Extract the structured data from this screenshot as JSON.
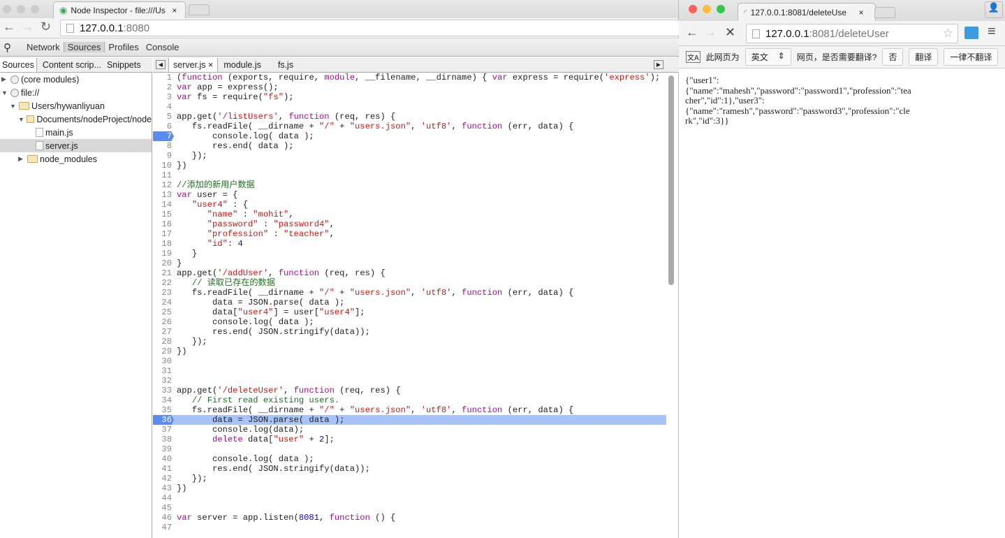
{
  "left_browser": {
    "tab_title": "Node Inspector - file:///Us",
    "url_host": "127.0.0.1",
    "url_rest": ":8080",
    "devtools_tabs": [
      "Network",
      "Sources",
      "Profiles",
      "Console"
    ],
    "navigator_tabs": [
      "Sources",
      "Content scrip...",
      "Snippets"
    ],
    "tree": [
      {
        "label": "(core modules)",
        "depth": 0,
        "icon": "globe-icon",
        "arrow": "▶"
      },
      {
        "label": "file://",
        "depth": 0,
        "icon": "globe-icon",
        "arrow": "▼"
      },
      {
        "label": "Users/hywanliyuan",
        "depth": 1,
        "icon": "folder-icon",
        "arrow": "▼"
      },
      {
        "label": "Documents/nodeProject/node",
        "depth": 2,
        "icon": "folder-icon",
        "arrow": "▼"
      },
      {
        "label": "main.js",
        "depth": 3,
        "icon": "file-icon",
        "arrow": ""
      },
      {
        "label": "server.js",
        "depth": 3,
        "icon": "file-icon",
        "arrow": "",
        "selected": true
      },
      {
        "label": "node_modules",
        "depth": 2,
        "icon": "folder-icon",
        "arrow": "▶"
      }
    ],
    "editor_tabs": [
      "server.js",
      "module.js",
      "fs.js"
    ],
    "breakpoint_line": 7,
    "current_line": 36,
    "code": [
      [
        [
          "p",
          "("
        ],
        [
          "k",
          "function"
        ],
        [
          "p",
          " (exports, require, "
        ],
        [
          "k",
          "module"
        ],
        [
          "p",
          ", __filename, __dirname) { "
        ],
        [
          "k",
          "var"
        ],
        [
          "p",
          " express = require("
        ],
        [
          "s",
          "'express'"
        ],
        [
          "p",
          ");"
        ]
      ],
      [
        [
          "k",
          "var"
        ],
        [
          "p",
          " app = express();"
        ]
      ],
      [
        [
          "k",
          "var"
        ],
        [
          "p",
          " fs = require("
        ],
        [
          "s",
          "\"fs\""
        ],
        [
          "p",
          ");"
        ]
      ],
      [],
      [
        [
          "p",
          "app.get("
        ],
        [
          "s",
          "'/listUsers'"
        ],
        [
          "p",
          ", "
        ],
        [
          "k",
          "function"
        ],
        [
          "p",
          " (req, res) {"
        ]
      ],
      [
        [
          "p",
          "   fs.readFile( __dirname + "
        ],
        [
          "s",
          "\"/\""
        ],
        [
          "p",
          " + "
        ],
        [
          "s",
          "\"users.json\""
        ],
        [
          "p",
          ", "
        ],
        [
          "s",
          "'utf8'"
        ],
        [
          "p",
          ", "
        ],
        [
          "k",
          "function"
        ],
        [
          "p",
          " (err, data) {"
        ]
      ],
      [
        [
          "p",
          "       console.log( data );"
        ]
      ],
      [
        [
          "p",
          "       res.end( data );"
        ]
      ],
      [
        [
          "p",
          "   });"
        ]
      ],
      [
        [
          "p",
          "})"
        ]
      ],
      [],
      [
        [
          "c",
          "//添加的新用户数据"
        ]
      ],
      [
        [
          "k",
          "var"
        ],
        [
          "p",
          " user = {"
        ]
      ],
      [
        [
          "p",
          "   "
        ],
        [
          "s",
          "\"user4\""
        ],
        [
          "p",
          " : {"
        ]
      ],
      [
        [
          "p",
          "      "
        ],
        [
          "s",
          "\"name\""
        ],
        [
          "p",
          " : "
        ],
        [
          "s",
          "\"mohit\""
        ],
        [
          "p",
          ","
        ]
      ],
      [
        [
          "p",
          "      "
        ],
        [
          "s",
          "\"password\""
        ],
        [
          "p",
          " : "
        ],
        [
          "s",
          "\"password4\""
        ],
        [
          "p",
          ","
        ]
      ],
      [
        [
          "p",
          "      "
        ],
        [
          "s",
          "\"profession\""
        ],
        [
          "p",
          " : "
        ],
        [
          "s",
          "\"teacher\""
        ],
        [
          "p",
          ","
        ]
      ],
      [
        [
          "p",
          "      "
        ],
        [
          "s",
          "\"id\""
        ],
        [
          "p",
          ": "
        ],
        [
          "n",
          "4"
        ]
      ],
      [
        [
          "p",
          "   }"
        ]
      ],
      [
        [
          "p",
          "}"
        ]
      ],
      [
        [
          "p",
          "app.get("
        ],
        [
          "s",
          "'/addUser'"
        ],
        [
          "p",
          ", "
        ],
        [
          "k",
          "function"
        ],
        [
          "p",
          " (req, res) {"
        ]
      ],
      [
        [
          "p",
          "   "
        ],
        [
          "c",
          "// 读取已存在的数据"
        ]
      ],
      [
        [
          "p",
          "   fs.readFile( __dirname + "
        ],
        [
          "s",
          "\"/\""
        ],
        [
          "p",
          " + "
        ],
        [
          "s",
          "\"users.json\""
        ],
        [
          "p",
          ", "
        ],
        [
          "s",
          "'utf8'"
        ],
        [
          "p",
          ", "
        ],
        [
          "k",
          "function"
        ],
        [
          "p",
          " (err, data) {"
        ]
      ],
      [
        [
          "p",
          "       data = JSON.parse( data );"
        ]
      ],
      [
        [
          "p",
          "       data["
        ],
        [
          "s",
          "\"user4\""
        ],
        [
          "p",
          "] = user["
        ],
        [
          "s",
          "\"user4\""
        ],
        [
          "p",
          "];"
        ]
      ],
      [
        [
          "p",
          "       console.log( data );"
        ]
      ],
      [
        [
          "p",
          "       res.end( JSON.stringify(data));"
        ]
      ],
      [
        [
          "p",
          "   });"
        ]
      ],
      [
        [
          "p",
          "})"
        ]
      ],
      [],
      [],
      [],
      [
        [
          "p",
          "app.get("
        ],
        [
          "s",
          "'/deleteUser'"
        ],
        [
          "p",
          ", "
        ],
        [
          "k",
          "function"
        ],
        [
          "p",
          " (req, res) {"
        ]
      ],
      [
        [
          "p",
          "   "
        ],
        [
          "c",
          "// First read existing users."
        ]
      ],
      [
        [
          "p",
          "   fs.readFile( __dirname + "
        ],
        [
          "s",
          "\"/\""
        ],
        [
          "p",
          " + "
        ],
        [
          "s",
          "\"users.json\""
        ],
        [
          "p",
          ", "
        ],
        [
          "s",
          "'utf8'"
        ],
        [
          "p",
          ", "
        ],
        [
          "k",
          "function"
        ],
        [
          "p",
          " (err, data) {"
        ]
      ],
      [
        [
          "p",
          "       data = JSON.parse( data );"
        ]
      ],
      [
        [
          "p",
          "       console.log(data);"
        ]
      ],
      [
        [
          "p",
          "       "
        ],
        [
          "k",
          "delete"
        ],
        [
          "p",
          " data["
        ],
        [
          "s",
          "\"user\""
        ],
        [
          "p",
          " + "
        ],
        [
          "n",
          "2"
        ],
        [
          "p",
          "];"
        ]
      ],
      [],
      [
        [
          "p",
          "       console.log( data );"
        ]
      ],
      [
        [
          "p",
          "       res.end( JSON.stringify(data));"
        ]
      ],
      [
        [
          "p",
          "   });"
        ]
      ],
      [
        [
          "p",
          "})"
        ]
      ],
      [],
      [],
      [
        [
          "k",
          "var"
        ],
        [
          "p",
          " server = app.listen("
        ],
        [
          "n",
          "8081"
        ],
        [
          "p",
          ", "
        ],
        [
          "k",
          "function"
        ],
        [
          "p",
          " () {"
        ]
      ],
      []
    ]
  },
  "right_browser": {
    "tab_title": "127.0.0.1:8081/deleteUse",
    "url_host": "127.0.0.1",
    "url_rest": ":8081/deleteUser",
    "translate": {
      "prefix": "此网页为",
      "language": "英文",
      "question": "网页，是否需要翻译?",
      "no": "否",
      "translate": "翻译",
      "never": "一律不翻译"
    },
    "body": "{\"user1\":\n{\"name\":\"mahesh\",\"password\":\"password1\",\"profession\":\"tea\ncher\",\"id\":1},\"user3\":\n{\"name\":\"ramesh\",\"password\":\"password3\",\"profession\":\"cle\nrk\",\"id\":3}}"
  }
}
